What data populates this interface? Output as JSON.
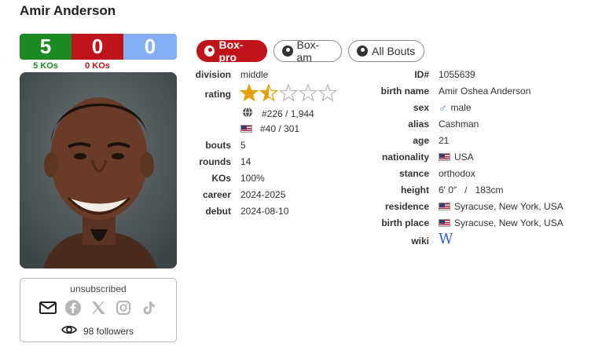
{
  "fighter": {
    "name": "Amir Anderson"
  },
  "record": {
    "wins": "5",
    "losses": "0",
    "draws": "0",
    "wins_kos": "5 KOs",
    "losses_kos": "0 KOs"
  },
  "follow": {
    "status": "unsubscribed",
    "followers": "98 followers"
  },
  "tabs": [
    {
      "label": "Box-pro"
    },
    {
      "label": "Box-am"
    },
    {
      "label": "All Bouts"
    }
  ],
  "left_info": {
    "division": {
      "label": "division",
      "value": "middle"
    },
    "rating": {
      "label": "rating",
      "stars": 1.5,
      "max_stars": 5,
      "world_rank": "#226 / 1,944",
      "country_rank": "#40 / 301"
    },
    "bouts": {
      "label": "bouts",
      "value": "5"
    },
    "rounds": {
      "label": "rounds",
      "value": "14"
    },
    "kos": {
      "label": "KOs",
      "value": "100%"
    },
    "career": {
      "label": "career",
      "value": "2024-2025"
    },
    "debut": {
      "label": "debut",
      "value": "2024-08-10"
    }
  },
  "right_info": {
    "id": {
      "label": "ID#",
      "value": "1055639"
    },
    "birth_name": {
      "label": "birth name",
      "value": "Amir Oshea Anderson"
    },
    "sex": {
      "label": "sex",
      "value": "male"
    },
    "alias": {
      "label": "alias",
      "value": "Cashman"
    },
    "age": {
      "label": "age",
      "value": "21"
    },
    "nationality": {
      "label": "nationality",
      "value": "USA"
    },
    "stance": {
      "label": "stance",
      "value": "orthodox"
    },
    "height": {
      "label": "height",
      "value": "6′ 0″   /   183cm"
    },
    "residence": {
      "label": "residence",
      "value": "Syracuse, New York, USA"
    },
    "birth_place": {
      "label": "birth place",
      "value": "Syracuse, New York, USA"
    },
    "wiki": {
      "label": "wiki",
      "value": "W"
    }
  },
  "colors": {
    "win": "#1c8a22",
    "loss": "#c0141a",
    "draw": "#84aff4",
    "star": "#e5a00d"
  }
}
